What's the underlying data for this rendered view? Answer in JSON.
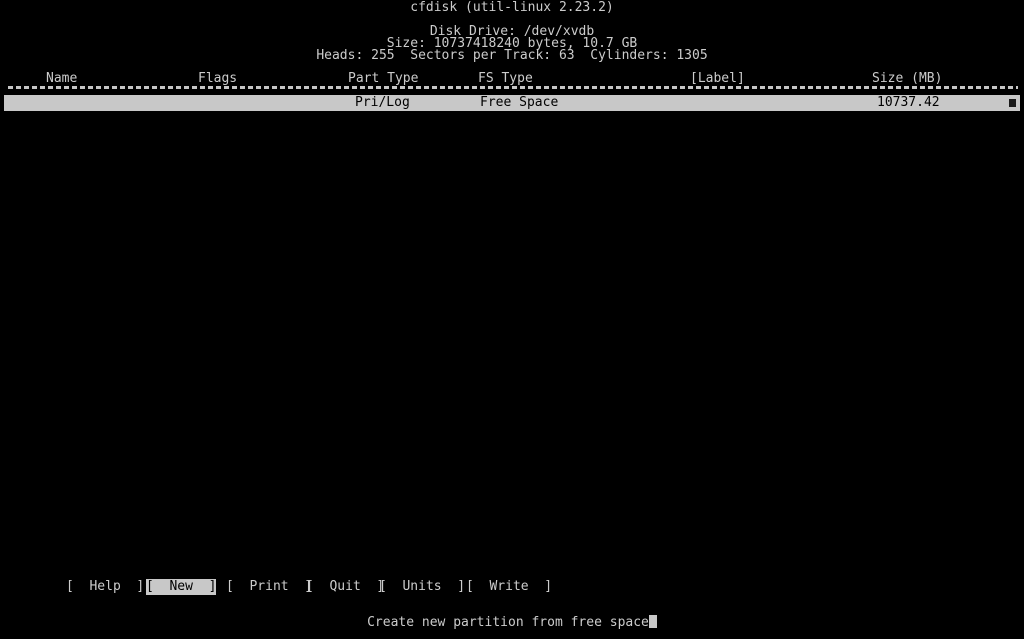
{
  "app": {
    "title": "cfdisk (util-linux 2.23.2)"
  },
  "disk_info": {
    "drive_line": "Disk Drive: /dev/xvdb",
    "size_line": "Size: 10737418240 bytes, 10.7 GB",
    "heads": "Heads: 255",
    "sectors_per_track": "Sectors per Track: 63",
    "cylinders": "Cylinders: 1305"
  },
  "table": {
    "headers": {
      "name": "Name",
      "flags": "Flags",
      "part_type": "Part Type",
      "fs_type": "FS Type",
      "label": "[Label]",
      "size": "Size (MB)"
    },
    "rows": [
      {
        "name": "",
        "flags": "",
        "part_type": "Pri/Log",
        "fs_type": "Free Space",
        "label": "",
        "size": "10737.42",
        "selected": true
      }
    ]
  },
  "menu": {
    "items": [
      {
        "label": "Help",
        "selected": false
      },
      {
        "label": "New",
        "selected": true
      },
      {
        "label": "Print",
        "selected": false
      },
      {
        "label": "Quit",
        "selected": false
      },
      {
        "label": "Units",
        "selected": false
      },
      {
        "label": "Write",
        "selected": false
      }
    ],
    "bracket_open": "[",
    "bracket_close": "]"
  },
  "status": {
    "message": "Create new partition from free space"
  },
  "colors": {
    "background": "#000000",
    "foreground": "#cccccc",
    "highlight_bg": "#c8c8c8",
    "highlight_fg": "#000000"
  }
}
